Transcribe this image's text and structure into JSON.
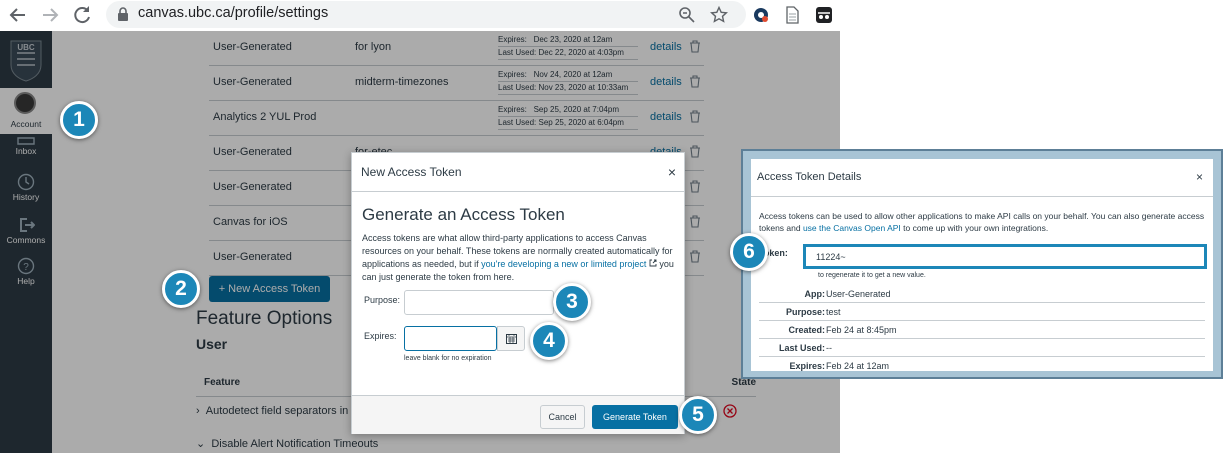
{
  "browser": {
    "url": "canvas.ubc.ca/profile/settings"
  },
  "sidebar": {
    "account_label": "Account",
    "items": [
      {
        "label": "Inbox",
        "icon": "inbox-icon"
      },
      {
        "label": "History",
        "icon": "history-icon"
      },
      {
        "label": "Commons",
        "icon": "commons-icon"
      },
      {
        "label": "Help",
        "icon": "help-icon"
      }
    ]
  },
  "tokens": [
    {
      "app": "User-Generated",
      "purpose": "for lyon",
      "expires_label": "Expires:",
      "expires": "Dec 23, 2020 at 12am",
      "last_used_label": "Last Used:",
      "last_used": "Dec 22, 2020 at 4:03pm",
      "details": "details"
    },
    {
      "app": "User-Generated",
      "purpose": "midterm-timezones",
      "expires_label": "Expires:",
      "expires": "Nov 24, 2020 at 12am",
      "last_used_label": "Last Used:",
      "last_used": "Nov 23, 2020 at 10:33am",
      "details": "details"
    },
    {
      "app": "Analytics 2 YUL Prod",
      "purpose": "",
      "expires_label": "Expires:",
      "expires": "Sep 25, 2020 at 7:04pm",
      "last_used_label": "Last Used:",
      "last_used": "Sep 25, 2020 at 6:04pm",
      "details": "details"
    },
    {
      "app": "User-Generated",
      "purpose": "for-etec",
      "expires_label": "",
      "expires": "",
      "last_used_label": "",
      "last_used": "",
      "details": "details"
    },
    {
      "app": "User-Generated",
      "purpose": "",
      "expires_label": "",
      "expires": "",
      "last_used_label": "",
      "last_used": "",
      "details": ""
    },
    {
      "app": "Canvas for iOS",
      "purpose": "",
      "expires_label": "",
      "expires": "",
      "last_used_label": "",
      "last_used": "",
      "details": ""
    },
    {
      "app": "User-Generated",
      "purpose": "",
      "expires_label": "",
      "expires": "",
      "last_used_label": "",
      "last_used": "",
      "details": ""
    }
  ],
  "new_token_button": "+ New Access Token",
  "features": {
    "title": "Feature Options",
    "subtitle": "User",
    "col_feature": "Feature",
    "col_state": "State",
    "rows": [
      "Autodetect field separators in",
      "Disable Alert Notification Timeouts"
    ]
  },
  "modal": {
    "title": "New Access Token",
    "close": "×",
    "heading": "Generate an Access Token",
    "desc_1": "Access tokens are what allow third-party applications to access Canvas resources on your behalf. These tokens are normally created automatically for applications as needed, but if ",
    "desc_link": "you're developing a new or limited project",
    "desc_2": " you can just generate the token from here.",
    "purpose_label": "Purpose:",
    "purpose_value": "",
    "expires_label": "Expires:",
    "expires_value": "",
    "expires_hint": "leave blank for no expiration",
    "cancel": "Cancel",
    "generate": "Generate Token"
  },
  "steps": [
    "1",
    "2",
    "3",
    "4",
    "5",
    "6"
  ],
  "details": {
    "title": "Access Token Details",
    "close": "×",
    "desc_1": "Access tokens can be used to allow other applications to make API calls on your behalf. You can also generate access tokens and ",
    "desc_link": "use the Canvas Open API",
    "desc_2": " to come up with your own integrations.",
    "token_label": "Token:",
    "token_value": "11224~",
    "regen_hint": "to regenerate it to get a new value.",
    "rows": [
      {
        "label": "App:",
        "value": "User-Generated"
      },
      {
        "label": "Purpose:",
        "value": "test"
      },
      {
        "label": "Created:",
        "value": "Feb 24 at 8:45pm"
      },
      {
        "label": "Last Used:",
        "value": "--"
      },
      {
        "label": "Expires:",
        "value": "Feb 24 at 12am"
      }
    ]
  },
  "colors": {
    "canvas_blue": "#0770a3",
    "sidebar": "#2d3b45",
    "step_circle": "#1c87b8"
  }
}
